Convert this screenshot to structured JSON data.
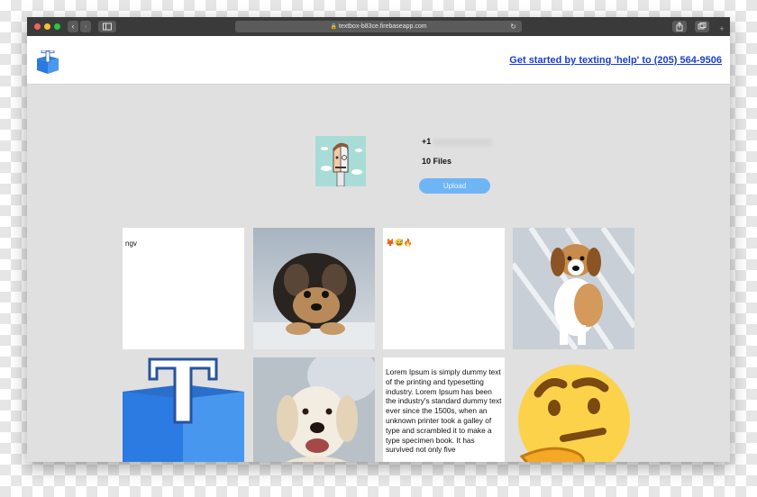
{
  "browser": {
    "url": "textbox-b83ce.firebaseapp.com",
    "reload_icon": "reload-icon",
    "share_icon": "share-icon",
    "tabs_icon": "tabs-icon",
    "new_tab_label": "+"
  },
  "header": {
    "logo_icon": "textbox-logo-icon",
    "cta_text": "Get started by texting 'help' to (205) 564-9506"
  },
  "profile": {
    "phone_prefix": "+1",
    "file_count": "10 Files",
    "upload_label": "Upload"
  },
  "files": [
    {
      "type": "text",
      "text": "ngv"
    },
    {
      "type": "image",
      "label": "fluffy black and tan puppy"
    },
    {
      "type": "text",
      "text": "🦊😅🔥"
    },
    {
      "type": "image",
      "label": "beagle puppy on deck"
    },
    {
      "type": "image",
      "label": "textbox logo"
    },
    {
      "type": "image",
      "label": "golden retriever"
    },
    {
      "type": "text",
      "text": "Lorem Ipsum is simply dummy text of the printing and typesetting industry. Lorem Ipsum has been the industry's standard dummy text ever since the 1500s, when an unknown printer took a galley of type and scrambled it to make a type specimen book. It has survived not only five"
    },
    {
      "type": "image",
      "label": "thinking face emoji"
    }
  ],
  "colors": {
    "accent_link": "#1a3fd0",
    "upload_button": "#6eb5f5",
    "page_bg": "#e0e0e0"
  }
}
